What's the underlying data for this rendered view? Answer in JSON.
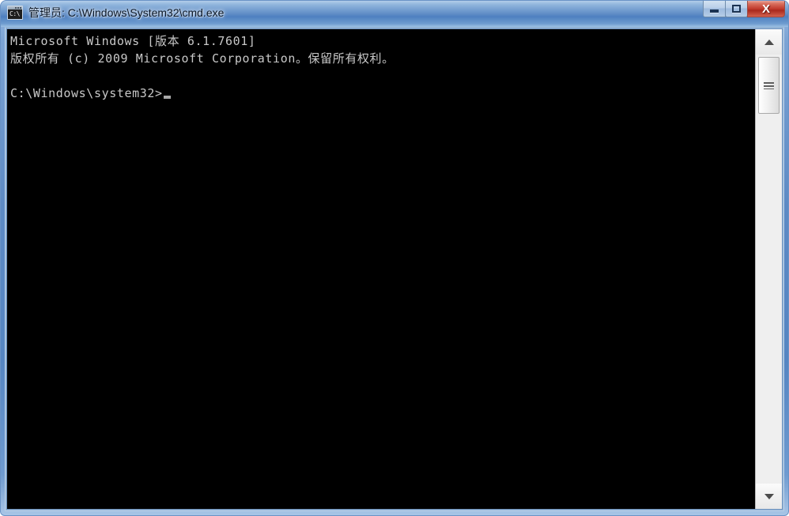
{
  "window": {
    "title": "管理员: C:\\Windows\\System32\\cmd.exe",
    "icon": "cmd-console-icon",
    "icon_text": "C:\\",
    "frame_color": "#5d8ac4",
    "titlebar_color": "#5f8cc6"
  },
  "controls": {
    "minimize_label": "—",
    "maximize_label": "□",
    "close_label": "X",
    "close_color": "#c0392b"
  },
  "console": {
    "background": "#000000",
    "foreground": "#c8c8c8",
    "lines": [
      "Microsoft Windows [版本 6.1.7601]",
      "版权所有 (c) 2009 Microsoft Corporation。保留所有权利。",
      "",
      "C:\\Windows\\system32>"
    ],
    "prompt": "C:\\Windows\\system32>",
    "cursor": "_"
  },
  "scrollbar": {
    "up_arrow": "▲",
    "down_arrow": "▼",
    "thumb_grip": "grip-lines"
  }
}
